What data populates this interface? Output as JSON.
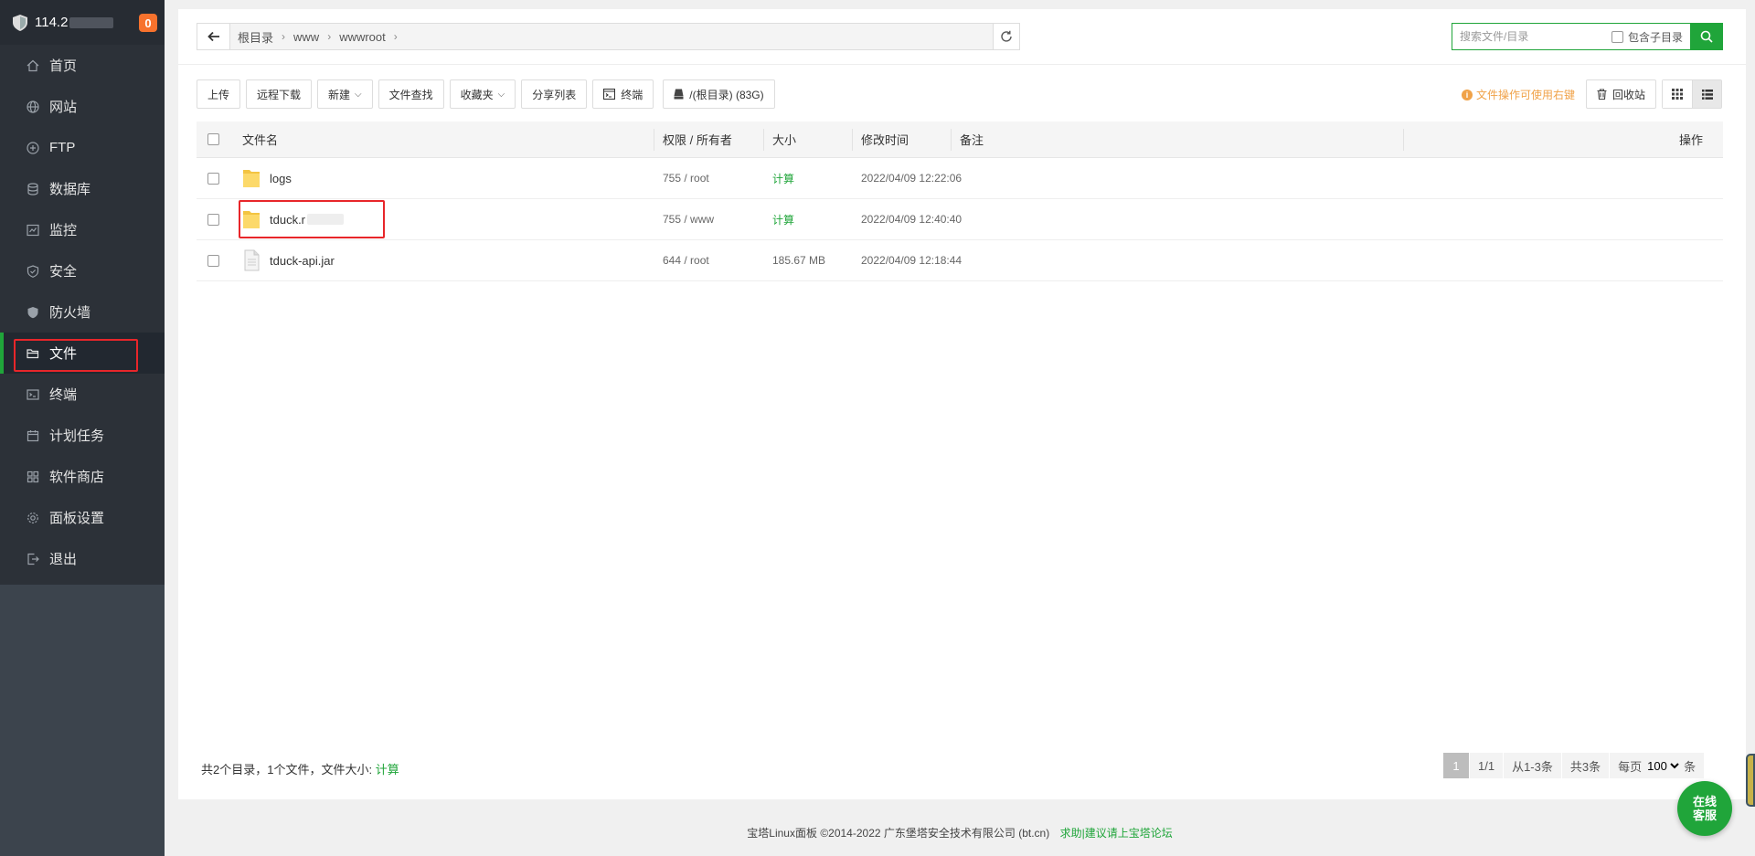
{
  "sidebar": {
    "server_ip": "114.2",
    "badge_count": "0",
    "items": [
      {
        "label": "首页",
        "icon": "home-icon"
      },
      {
        "label": "网站",
        "icon": "globe-icon"
      },
      {
        "label": "FTP",
        "icon": "ftp-icon"
      },
      {
        "label": "数据库",
        "icon": "database-icon"
      },
      {
        "label": "监控",
        "icon": "monitor-icon"
      },
      {
        "label": "安全",
        "icon": "shield-check-icon"
      },
      {
        "label": "防火墙",
        "icon": "firewall-icon"
      },
      {
        "label": "文件",
        "icon": "folder-icon"
      },
      {
        "label": "终端",
        "icon": "terminal-icon"
      },
      {
        "label": "计划任务",
        "icon": "calendar-icon"
      },
      {
        "label": "软件商店",
        "icon": "apps-icon"
      },
      {
        "label": "面板设置",
        "icon": "settings-icon"
      },
      {
        "label": "退出",
        "icon": "logout-icon"
      }
    ],
    "active_item": "文件"
  },
  "path": {
    "crumbs": [
      "根目录",
      "www",
      "wwwroot"
    ]
  },
  "search": {
    "placeholder": "搜索文件/目录",
    "include_sub_label": "包含子目录"
  },
  "toolbar": {
    "upload": "上传",
    "remote_download": "远程下载",
    "new": "新建",
    "find": "文件查找",
    "favorites": "收藏夹",
    "share_list": "分享列表",
    "terminal": "终端",
    "disk": "/(根目录) (83G)",
    "tip": "文件操作可使用右键",
    "recycle": "回收站"
  },
  "table": {
    "headers": {
      "name": "文件名",
      "perm": "权限 / 所有者",
      "size": "大小",
      "mtime": "修改时间",
      "note": "备注",
      "op": "操作"
    },
    "rows": [
      {
        "type": "folder",
        "name": "logs",
        "perm": "755 / root",
        "size": "计算",
        "mtime": "2022/04/09 12:22:06"
      },
      {
        "type": "folder",
        "name": "tduck.r",
        "perm": "755 / www",
        "size": "计算",
        "mtime": "2022/04/09 12:40:40"
      },
      {
        "type": "file",
        "name": "tduck-api.jar",
        "perm": "644 / root",
        "size": "185.67 MB",
        "mtime": "2022/04/09 12:18:44"
      }
    ]
  },
  "summary": {
    "text": "共2个目录，1个文件，文件大小: ",
    "link": "计算"
  },
  "pager": {
    "current": "1",
    "pages": "1/1",
    "range": "从1-3条",
    "total": "共3条",
    "per_page_label": "每页",
    "per_page": "100",
    "unit": "条"
  },
  "footer": {
    "copyright": "宝塔Linux面板 ©2014-2022 广东堡塔安全技术有限公司 (bt.cn)",
    "link": "求助|建议请上宝塔论坛"
  },
  "chat": {
    "line1": "在线",
    "line2": "客服"
  },
  "colors": {
    "accent": "#20a53a",
    "sidebar": "#3c444d",
    "highlight": "#e8262a"
  }
}
